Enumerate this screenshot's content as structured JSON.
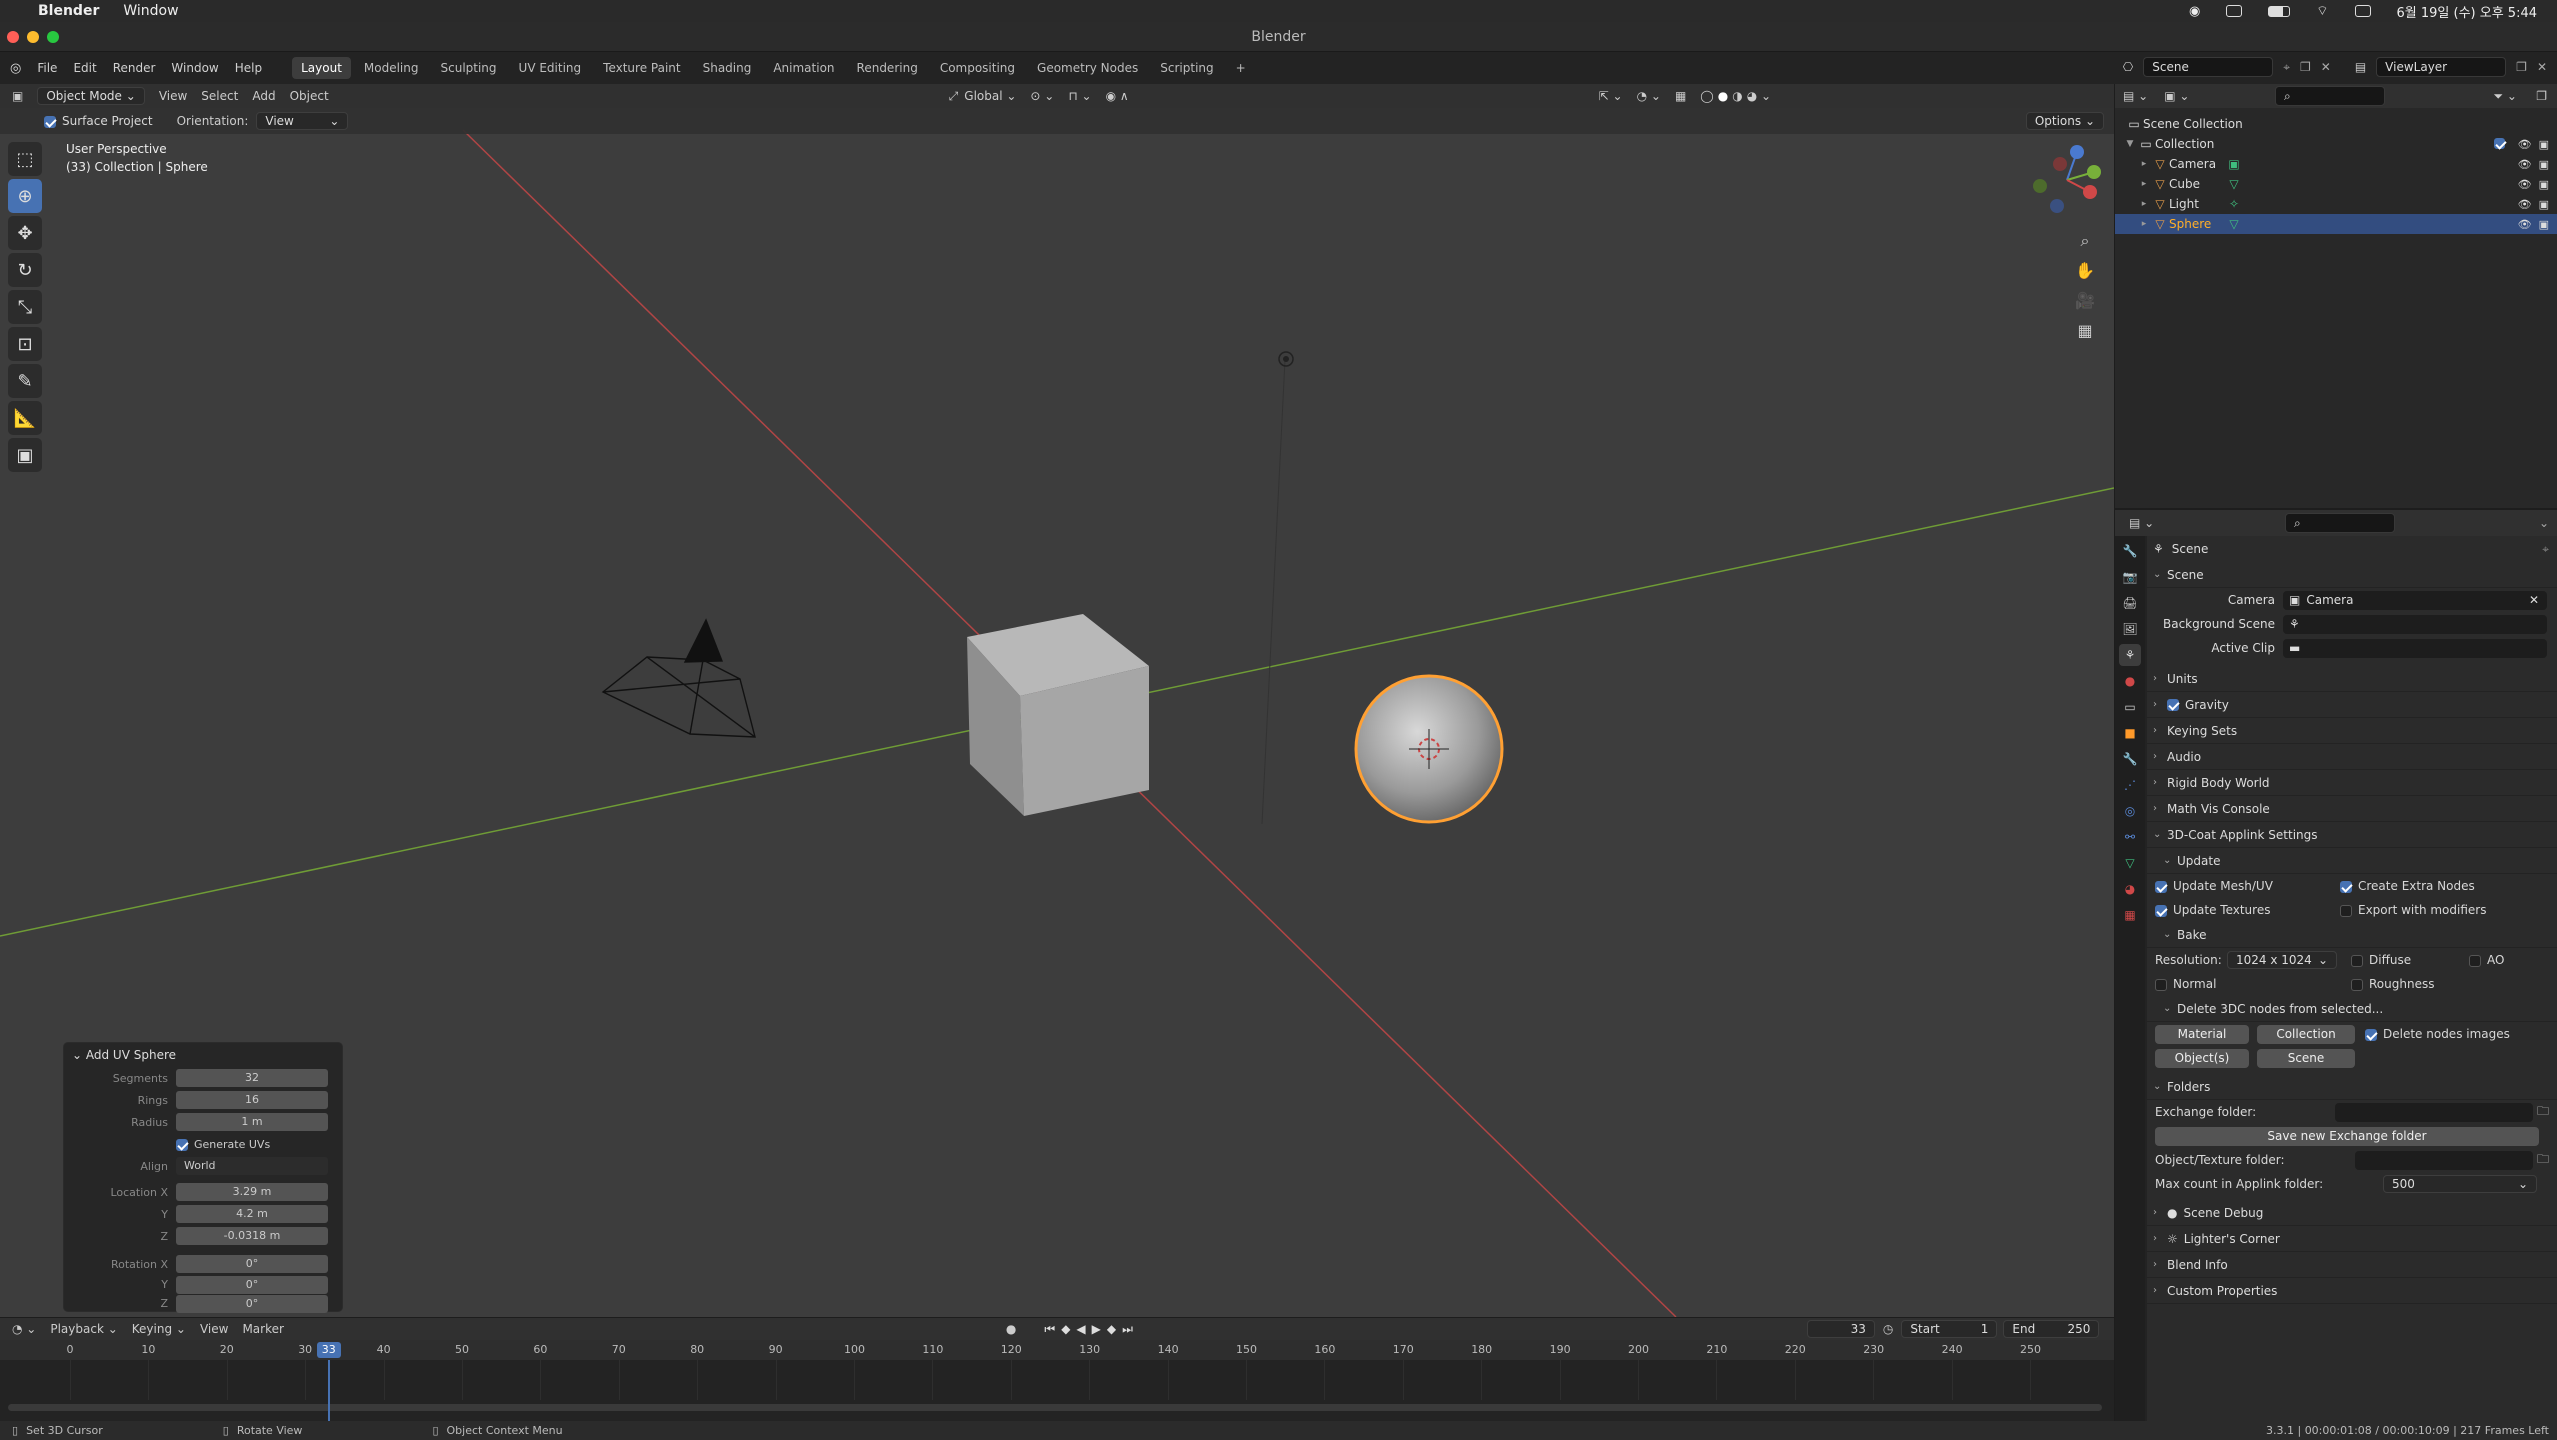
{
  "mac_menubar": {
    "app_name": "Blender",
    "menu_window": "Window",
    "datetime": "6월 19일 (수) 오후 5:44"
  },
  "window": {
    "title": "Blender"
  },
  "app_menu": {
    "file": "File",
    "edit": "Edit",
    "render": "Render",
    "window": "Window",
    "help": "Help"
  },
  "workspaces": [
    "Layout",
    "Modeling",
    "Sculpting",
    "UV Editing",
    "Texture Paint",
    "Shading",
    "Animation",
    "Rendering",
    "Compositing",
    "Geometry Nodes",
    "Scripting"
  ],
  "active_workspace": "Layout",
  "add_workspace": "+",
  "scene_selector": "Scene",
  "viewlayer_selector": "ViewLayer",
  "viewport_header": {
    "mode": "Object Mode",
    "view": "View",
    "select": "Select",
    "add": "Add",
    "object": "Object",
    "transform_orientation": "Global",
    "surface_project": "Surface Project",
    "orientation_label": "Orientation:",
    "orientation_value": "View",
    "options": "Options"
  },
  "viewport": {
    "perspective_label": "User Perspective",
    "collection_label": "(33) Collection | Sphere"
  },
  "operator_panel": {
    "title": "Add UV Sphere",
    "rows": [
      {
        "label": "Segments",
        "value": "32"
      },
      {
        "label": "Rings",
        "value": "16"
      },
      {
        "label": "Radius",
        "value": "1 m"
      }
    ],
    "generate_uvs": "Generate UVs",
    "align_label": "Align",
    "align_value": "World",
    "location": [
      {
        "label": "Location X",
        "value": "3.29 m"
      },
      {
        "label": "Y",
        "value": "4.2 m"
      },
      {
        "label": "Z",
        "value": "-0.0318 m"
      }
    ],
    "rotation": [
      {
        "label": "Rotation X",
        "value": "0°"
      },
      {
        "label": "Y",
        "value": "0°"
      },
      {
        "label": "Z",
        "value": "0°"
      }
    ]
  },
  "outliner": {
    "scene_collection": "Scene Collection",
    "collection": "Collection",
    "items": [
      {
        "name": "Camera",
        "icon": "camera-icon",
        "color": "#e09a4a"
      },
      {
        "name": "Cube",
        "icon": "mesh-icon",
        "color": "#e09a4a"
      },
      {
        "name": "Light",
        "icon": "light-icon",
        "color": "#e09a4a"
      },
      {
        "name": "Sphere",
        "icon": "mesh-icon",
        "color": "#e09a4a",
        "selected": true
      }
    ]
  },
  "properties": {
    "context_title": "Scene",
    "scene_section": "Scene",
    "camera_label": "Camera",
    "camera_value": "Camera",
    "background_scene_label": "Background Scene",
    "active_clip_label": "Active Clip",
    "sections_collapsed": [
      "Units",
      "Gravity",
      "Keying Sets",
      "Audio",
      "Rigid Body World",
      "Math Vis Console"
    ],
    "coat_section": "3D-Coat Applink Settings",
    "update_section": "Update",
    "update_mesh_uv": "Update Mesh/UV",
    "create_extra_nodes": "Create Extra Nodes",
    "update_textures": "Update Textures",
    "export_with_modifiers": "Export with modifiers",
    "bake_section": "Bake",
    "resolution_label": "Resolution:",
    "resolution_value": "1024 x 1024",
    "diffuse": "Diffuse",
    "ao": "AO",
    "normal": "Normal",
    "roughness": "Roughness",
    "delete_section": "Delete 3DC nodes from selected...",
    "material_btn": "Material",
    "collection_btn": "Collection",
    "delete_nodes_images": "Delete nodes images",
    "objects_btn": "Object(s)",
    "scene_btn": "Scene",
    "folders_section": "Folders",
    "exchange_folder_label": "Exchange folder:",
    "save_exchange_btn": "Save new Exchange folder",
    "object_texture_folder_label": "Object/Texture folder:",
    "max_count_label": "Max count in Applink folder:",
    "max_count_value": "500",
    "bottom_sections": [
      "Scene Debug",
      "Lighter's Corner",
      "Blend Info",
      "Custom Properties"
    ]
  },
  "timeline": {
    "playback": "Playback",
    "keying": "Keying",
    "view": "View",
    "marker": "Marker",
    "current_frame": "33",
    "start_label": "Start",
    "start_value": "1",
    "end_label": "End",
    "end_value": "250",
    "ticks": [
      "0",
      "10",
      "20",
      "30",
      "40",
      "50",
      "60",
      "70",
      "80",
      "90",
      "100",
      "110",
      "120",
      "130",
      "140",
      "150",
      "160",
      "170",
      "180",
      "190",
      "200",
      "210",
      "220",
      "230",
      "240",
      "250"
    ]
  },
  "statusbar": {
    "set_cursor": "Set 3D Cursor",
    "rotate_view": "Rotate View",
    "object_context_menu": "Object Context Menu",
    "version_info": "3.3.1 | 00:00:01:08 / 00:00:10:09 | 217 Frames Left"
  },
  "colors": {
    "accent_blue": "#4772b3",
    "selection_orange": "#ffaf29",
    "x_axis": "#d04848",
    "y_axis": "#7eb03a",
    "frame_indicator": "#4772b3"
  }
}
